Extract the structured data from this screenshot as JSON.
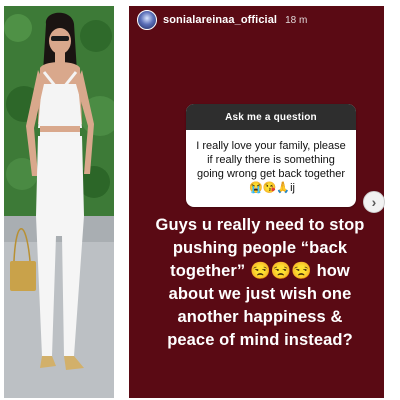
{
  "story": {
    "username": "sonialareinaa_official",
    "time_ago": "18 m",
    "question_sticker": {
      "title": "Ask me a question",
      "text": "I really love your family, please if really there is something going wrong get back together",
      "emojis": "😭😘🙏ij"
    },
    "caption": "Guys u really need to stop pushing people “back together” 😒😒😒 how about we just wish one another happiness & peace of mind instead?"
  },
  "controls": {
    "next_glyph": "›"
  },
  "colors": {
    "story_background": "#5a0a14",
    "sticker_header": "#2e2e2e"
  }
}
